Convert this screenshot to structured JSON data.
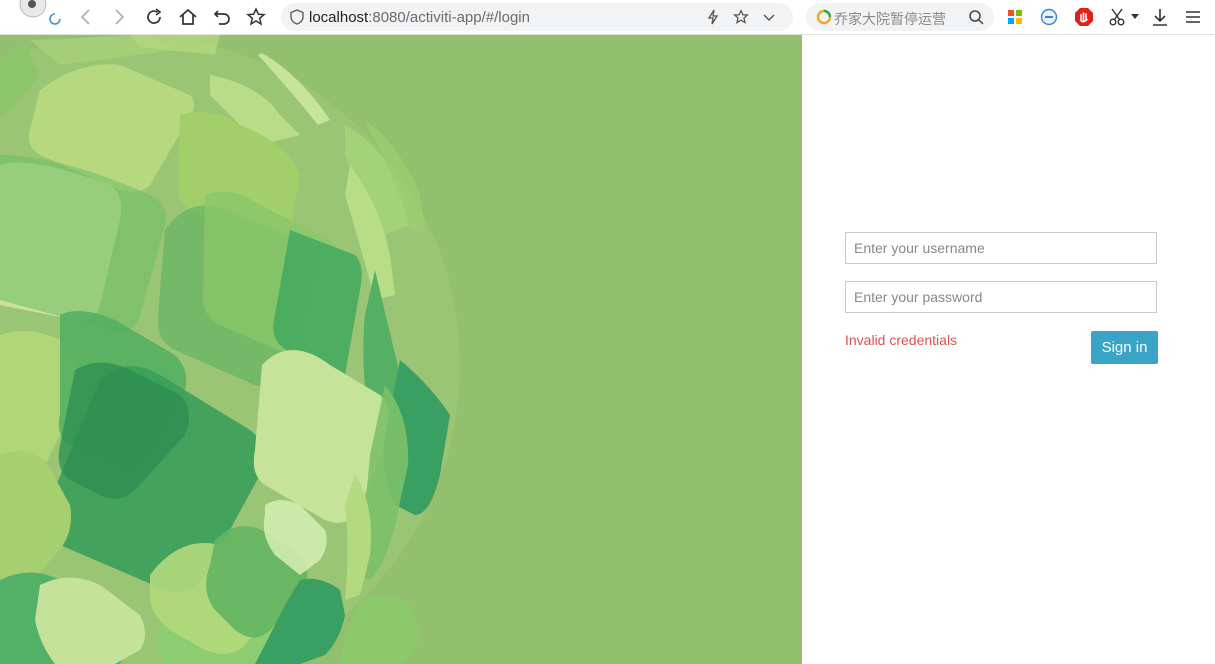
{
  "browser": {
    "url_host": "localhost",
    "url_rest": ":8080/activiti-app/#/login",
    "search_placeholder": "乔家大院暂停运营"
  },
  "login": {
    "username_placeholder": "Enter your username",
    "password_placeholder": "Enter your password",
    "error_message": "Invalid credentials",
    "signin_label": "Sign in"
  },
  "colors": {
    "hero_background": "#92c06f",
    "signin_button": "#3aa4c6",
    "error_text": "#d9534f"
  }
}
